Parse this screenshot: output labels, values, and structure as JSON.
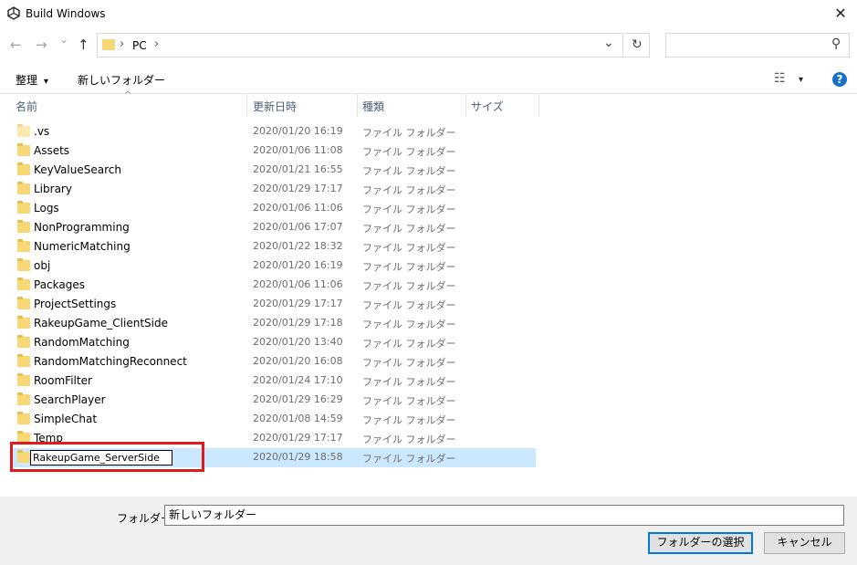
{
  "window": {
    "title": "Build Windows",
    "close_glyph": "✕"
  },
  "nav": {
    "back_glyph": "←",
    "forward_glyph": "→",
    "recent_glyph": "⌄",
    "up_glyph": "↑",
    "breadcrumb_sep": "›",
    "location": "PC",
    "location_sep": "›",
    "dropdown_glyph": "⌄",
    "refresh_glyph": "↻",
    "search_value": "",
    "search_glyph": "⚲"
  },
  "toolbar": {
    "organize_label": "整理",
    "organize_arrow": "▾",
    "new_folder_label": "新しいフォルダー",
    "view_glyph": "☷",
    "view_arrow": "▾",
    "help_glyph": "?"
  },
  "columns": {
    "sort_glyph": "^",
    "name": "名前",
    "date": "更新日時",
    "type": "種類",
    "size": "サイズ"
  },
  "files": [
    {
      "name": ".vs",
      "date": "2020/01/20 16:19",
      "type": "ファイル フォルダー"
    },
    {
      "name": "Assets",
      "date": "2020/01/06 11:08",
      "type": "ファイル フォルダー"
    },
    {
      "name": "KeyValueSearch",
      "date": "2020/01/21 16:55",
      "type": "ファイル フォルダー"
    },
    {
      "name": "Library",
      "date": "2020/01/29 17:17",
      "type": "ファイル フォルダー"
    },
    {
      "name": "Logs",
      "date": "2020/01/06 11:06",
      "type": "ファイル フォルダー"
    },
    {
      "name": "NonProgramming",
      "date": "2020/01/06 17:07",
      "type": "ファイル フォルダー"
    },
    {
      "name": "NumericMatching",
      "date": "2020/01/22 18:32",
      "type": "ファイル フォルダー"
    },
    {
      "name": "obj",
      "date": "2020/01/20 16:19",
      "type": "ファイル フォルダー"
    },
    {
      "name": "Packages",
      "date": "2020/01/06 11:06",
      "type": "ファイル フォルダー"
    },
    {
      "name": "ProjectSettings",
      "date": "2020/01/29 17:17",
      "type": "ファイル フォルダー"
    },
    {
      "name": "RakeupGame_ClientSide",
      "date": "2020/01/29 17:18",
      "type": "ファイル フォルダー"
    },
    {
      "name": "RandomMatching",
      "date": "2020/01/20 13:40",
      "type": "ファイル フォルダー"
    },
    {
      "name": "RandomMatchingReconnect",
      "date": "2020/01/20 16:08",
      "type": "ファイル フォルダー"
    },
    {
      "name": "RoomFilter",
      "date": "2020/01/24 17:10",
      "type": "ファイル フォルダー"
    },
    {
      "name": "SearchPlayer",
      "date": "2020/01/29 16:29",
      "type": "ファイル フォルダー"
    },
    {
      "name": "SimpleChat",
      "date": "2020/01/08 14:59",
      "type": "ファイル フォルダー"
    },
    {
      "name": "Temp",
      "date": "2020/01/29 17:17",
      "type": "ファイル フォルダー"
    },
    {
      "name": "RakeupGame_ServerSide",
      "date": "2020/01/29 18:58",
      "type": "ファイル フォルダー"
    }
  ],
  "bottom": {
    "folder_label": "フォルダー:",
    "folder_value": "新しいフォルダー",
    "select_label": "フォルダーの選択",
    "cancel_label": "キャンセル"
  },
  "colors": {
    "selection": "#cce8ff",
    "highlight_box": "#e01b1b",
    "accent": "#0078d7"
  }
}
